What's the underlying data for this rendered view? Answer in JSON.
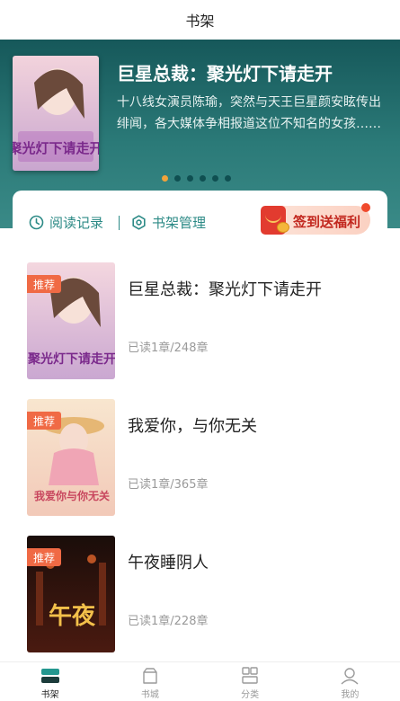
{
  "header": {
    "title": "书架"
  },
  "hero": {
    "title": "巨星总裁：聚光灯下请走开",
    "description": "十八线女演员陈瑜，突然与天王巨星颜安眩传出绯闻，各大媒体争相报道这位不知名的女孩……",
    "cover_text": "聚光灯下请走开",
    "dots_count": 6,
    "active_dot": 0
  },
  "toolbar": {
    "read_history": "阅读记录",
    "manage": "书架管理",
    "signin": "签到送福利"
  },
  "books": [
    {
      "title": "巨星总裁：聚光灯下请走开",
      "progress": "已读1章/248章",
      "tag": "推荐",
      "cover_text": "聚光灯下请走开"
    },
    {
      "title": "我爱你，与你无关",
      "progress": "已读1章/365章",
      "tag": "推荐",
      "cover_text": "我爱你与你无关"
    },
    {
      "title": "午夜睡阴人",
      "progress": "已读1章/228章",
      "tag": "推荐",
      "cover_text": "午夜"
    }
  ],
  "tabbar": [
    {
      "label": "书架",
      "icon": "bookshelf-icon",
      "active": true
    },
    {
      "label": "书城",
      "icon": "bookstore-icon",
      "active": false
    },
    {
      "label": "分类",
      "icon": "category-icon",
      "active": false
    },
    {
      "label": "我的",
      "icon": "profile-icon",
      "active": false
    }
  ],
  "colors": {
    "accent": "#2c8a86",
    "hero": "#1f6a6a",
    "tag": "#f06a45",
    "dot_active": "#f2a33a"
  }
}
